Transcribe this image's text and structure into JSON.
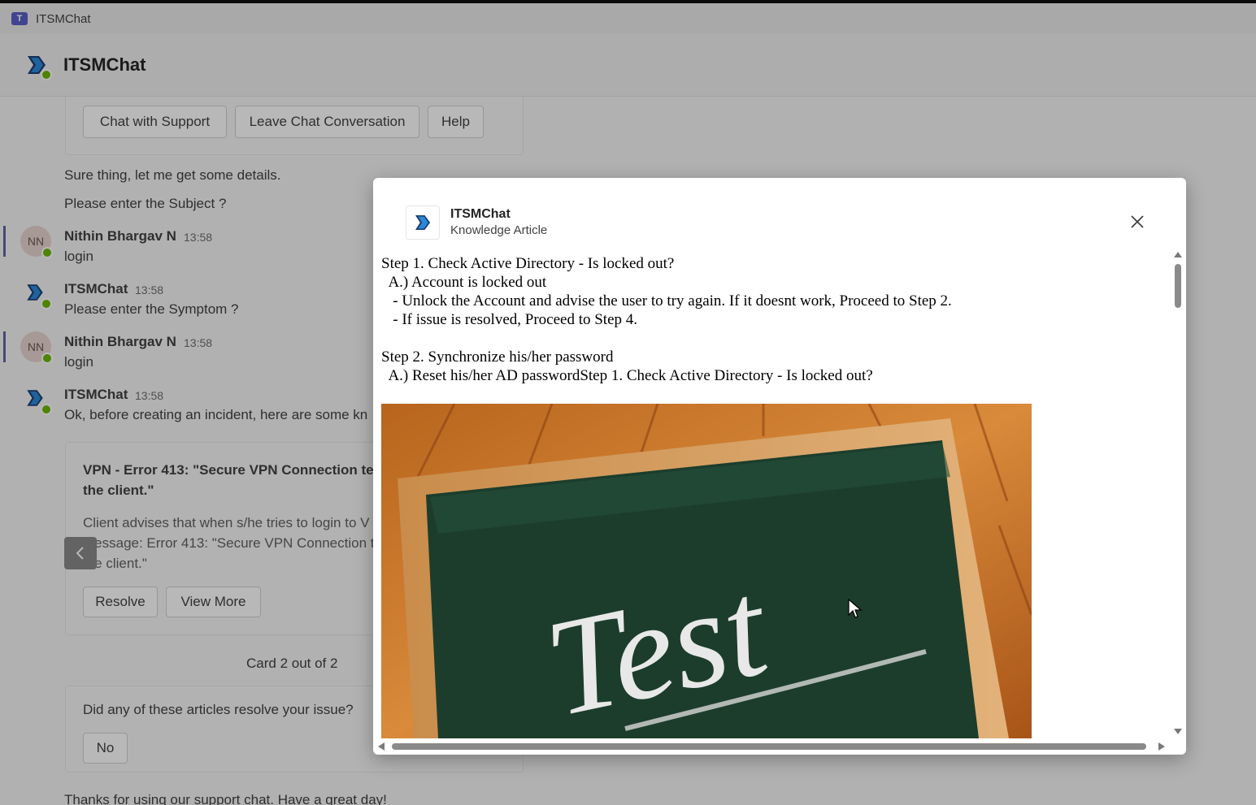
{
  "titlebar": {
    "app_icon": "teams-icon",
    "title": "ITSMChat"
  },
  "header": {
    "name": "ITSMChat",
    "logo": "itsmchat-logo-icon",
    "status_color": "#6bb700"
  },
  "chat": {
    "top_buttons": [
      "Chat with Support",
      "Leave Chat Conversation",
      "Help"
    ],
    "msg_sure": "Sure thing, let me get some details.",
    "msg_subject": "Please enter the Subject ?",
    "messages": [
      {
        "initials": "NN",
        "sender": "Nithin Bhargav N",
        "time": "13:58",
        "text": "login"
      },
      {
        "sender": "ITSMChat",
        "time": "13:58",
        "text": "Please enter the Symptom ?"
      },
      {
        "initials": "NN",
        "sender": "Nithin Bhargav N",
        "time": "13:58",
        "text": "login"
      },
      {
        "sender": "ITSMChat",
        "time": "13:58",
        "text": "Ok, before creating an incident, here are some kn"
      }
    ],
    "card": {
      "title_line1": "VPN - Error 413: \"Secure VPN Connection ter",
      "title_line2": "the client.\"",
      "body_line1": "Client advises that when s/he tries to login to V",
      "body_line2": "message: Error 413: \"Secure VPN Connection t",
      "body_line3": "the client.\"",
      "buttons": [
        "Resolve",
        "View More"
      ],
      "counter": "Card 2 out of 2"
    },
    "question": "Did any of these articles resolve your issue?",
    "no_button": "No",
    "goodbye": "Thanks for using our support chat. Have a great day!"
  },
  "dialog": {
    "title": "ITSMChat",
    "subtitle": "Knowledge Article",
    "article_lines": [
      "Step 1. Check Active Directory - Is locked out?",
      "  A.) Account is locked out",
      "   - Unlock the Account and advise the user to try again. If it doesnt work, Proceed to Step 2.",
      "   - If issue is resolved, Proceed to Step 4.",
      "",
      "Step 2. Synchronize his/her password",
      "  A.) Reset his/her AD passwordStep 1. Check Active Directory - Is locked out?"
    ],
    "image_text": "Test",
    "accent": "#1f85d6"
  }
}
